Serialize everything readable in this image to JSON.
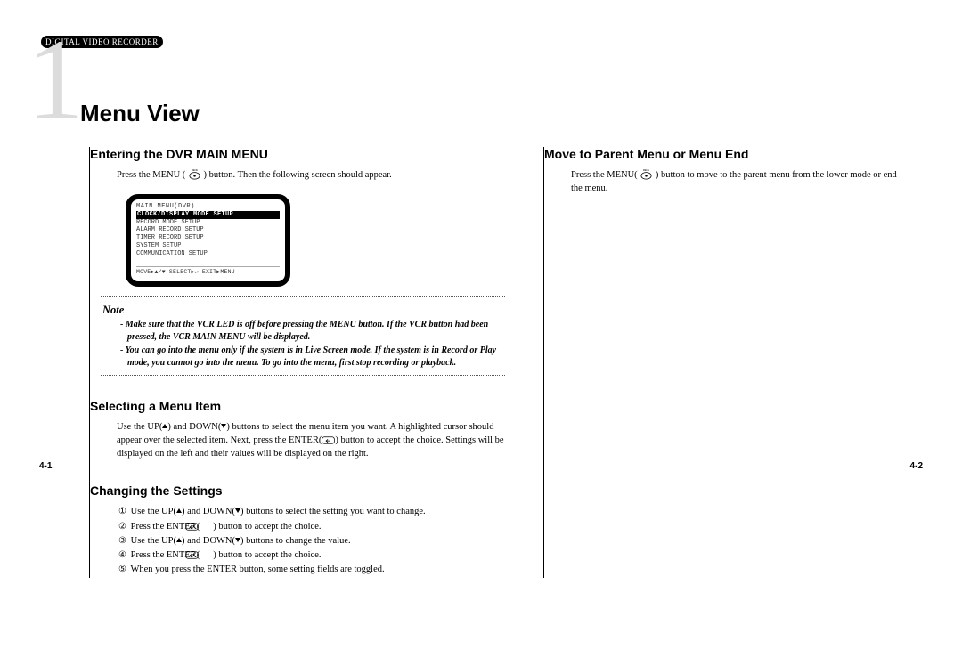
{
  "header": {
    "product_tag": "DIGITAL VIDEO RECORDER"
  },
  "chapter": {
    "number": "1",
    "title": "Menu View"
  },
  "left": {
    "sec1": {
      "title": "Entering the DVR MAIN MENU",
      "body_pre": "Press the MENU (",
      "body_post": ") button. Then the following screen should appear."
    },
    "monitor": {
      "title": "MAIN MENU(DVR)",
      "line_hl": "CLOCK/DISPLAY MODE SETUP",
      "l2": "RECORD MODE SETUP",
      "l3": "ALARM RECORD SETUP",
      "l4": "TIMER RECORD SETUP",
      "l5": "SYSTEM SETUP",
      "l6": "COMMUNICATION SETUP",
      "footer": "MOVE▶▲/▼  SELECT▶↵  EXIT▶MENU"
    },
    "note": {
      "label": "Note",
      "n1": "- Make sure that the VCR LED is off before pressing the MENU button. If the VCR button had been pressed, the VCR MAIN MENU will be displayed.",
      "n2": "- You can go into the menu only if the system is in Live Screen mode. If the system is in Record or Play mode, you cannot go into the menu. To go into the menu, first stop recording or playback."
    },
    "sec2": {
      "title": "Selecting a Menu Item",
      "body_a": "Use the UP(",
      "body_b": ") and DOWN(",
      "body_c": ") buttons to select the menu item you want. A highlighted cursor should appear over the selected item. Next, press the ENTER(",
      "body_d": ") button to accept the choice. Settings will be displayed on the left and their values will be displayed on the right."
    },
    "sec3": {
      "title": "Changing the Settings",
      "s1a": "Use the UP(",
      "s1b": ") and DOWN(",
      "s1c": ") buttons to select the setting you want to change.",
      "s2a": "Press the ENTER(",
      "s2b": ") button to accept the choice.",
      "s3a": "Use the UP(",
      "s3b": ") and DOWN(",
      "s3c": ") buttons to change the value.",
      "s4a": "Press the ENTER(",
      "s4b": ") button to accept the choice.",
      "s5": "When you press the ENTER button, some setting fields are toggled."
    },
    "circled": {
      "n1": "①",
      "n2": "②",
      "n3": "③",
      "n4": "④",
      "n5": "⑤"
    }
  },
  "right": {
    "sec1": {
      "title": "Move to Parent Menu or Menu End",
      "body_pre": "Press the MENU(",
      "body_post": ") button to move to the parent menu from the lower mode or end the menu."
    }
  },
  "pages": {
    "left": "4-1",
    "right": "4-2"
  }
}
